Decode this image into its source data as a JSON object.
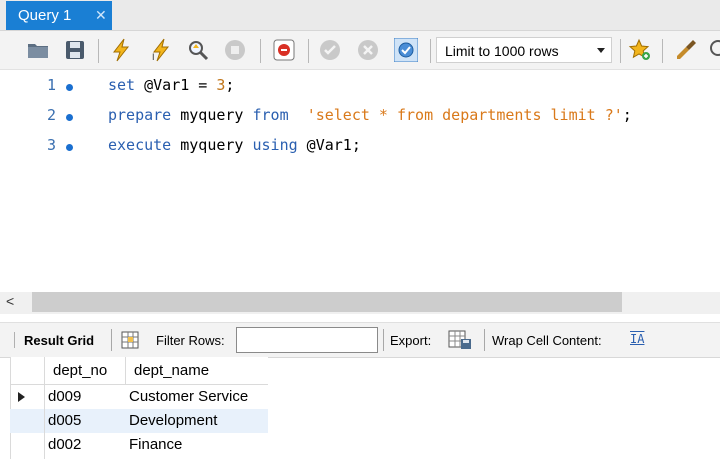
{
  "tab": {
    "title": "Query 1",
    "close": "✕",
    "color": "#1a7fd4"
  },
  "toolbar": {
    "icons": [
      "open-folder-icon",
      "save-icon",
      "execute-icon",
      "execute-current-icon",
      "explain-icon",
      "stop-icon",
      "toggle-error-icon",
      "commit-icon",
      "rollback-icon",
      "autocommit-icon",
      "bookmark-icon",
      "beautify-icon",
      "search-icon"
    ],
    "limit_value": "Limit to 1000 rows"
  },
  "editor": {
    "lines": [
      {
        "num": "1",
        "tokens": [
          {
            "t": "set",
            "c": "kw"
          },
          {
            "t": " @Var1 = ",
            "c": ""
          },
          {
            "t": "3",
            "c": "num"
          },
          {
            "t": ";",
            "c": ""
          }
        ]
      },
      {
        "num": "2",
        "tokens": [
          {
            "t": "prepare",
            "c": "kw"
          },
          {
            "t": " myquery ",
            "c": ""
          },
          {
            "t": "from",
            "c": "kw"
          },
          {
            "t": "  ",
            "c": ""
          },
          {
            "t": "'select * from departments limit ?'",
            "c": "str"
          },
          {
            "t": ";",
            "c": ""
          }
        ]
      },
      {
        "num": "3",
        "tokens": [
          {
            "t": "execute",
            "c": "kw"
          },
          {
            "t": " myquery ",
            "c": ""
          },
          {
            "t": "using",
            "c": "kw"
          },
          {
            "t": " @Var1;",
            "c": ""
          }
        ]
      }
    ]
  },
  "scroll": {
    "left_arrow": "<"
  },
  "results": {
    "result_grid_label": "Result Grid",
    "filter_label": "Filter Rows:",
    "filter_value": "",
    "export_label": "Export:",
    "wrap_label": "Wrap Cell Content:",
    "wrap_icon": "IA"
  },
  "grid": {
    "columns": [
      "dept_no",
      "dept_name"
    ],
    "rows": [
      [
        "d009",
        "Customer Service"
      ],
      [
        "d005",
        "Development"
      ],
      [
        "d002",
        "Finance"
      ]
    ]
  }
}
